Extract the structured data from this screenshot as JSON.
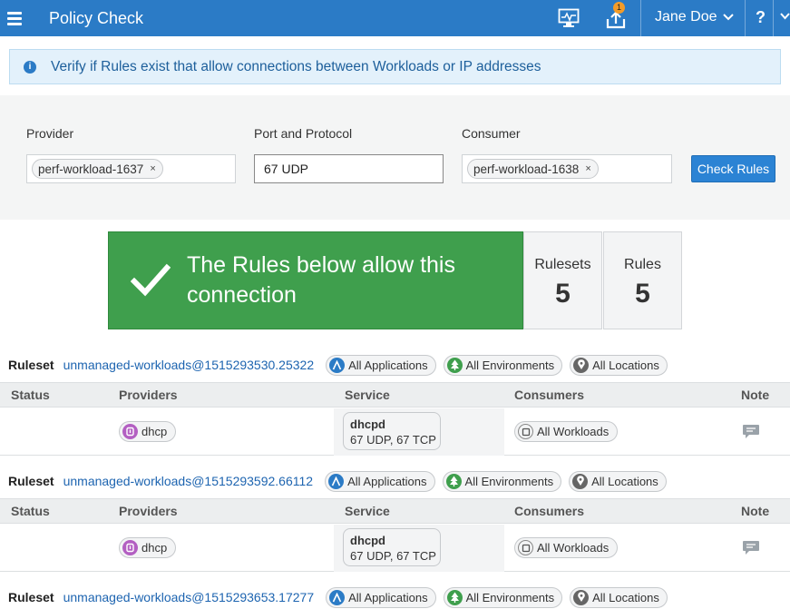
{
  "header": {
    "menu_icon": "hamburger-icon",
    "title": "Policy Check",
    "monitor_icon": "monitor-icon",
    "upload_icon": "upload-icon",
    "notification_count": "1",
    "user_name": "Jane Doe",
    "help_label": "?"
  },
  "info": {
    "icon": "info-icon",
    "text": "Verify if Rules exist that allow connections between Workloads or IP addresses"
  },
  "form": {
    "provider_label": "Provider",
    "provider_chip": "perf-workload-1637",
    "port_label": "Port and Protocol",
    "port_value": "67 UDP",
    "consumer_label": "Consumer",
    "consumer_chip": "perf-workload-1638",
    "check_button": "Check Rules",
    "chip_remove": "×"
  },
  "result": {
    "message": "The Rules below allow this connection",
    "rulesets_label": "Rulesets",
    "rulesets_count": "5",
    "rules_label": "Rules",
    "rules_count": "5",
    "colors": {
      "success": "#3f9f4d"
    }
  },
  "table_columns": {
    "status": "Status",
    "providers": "Providers",
    "service": "Service",
    "consumers": "Consumers",
    "note": "Note"
  },
  "rulesets": [
    {
      "label": "Ruleset",
      "name": "unmanaged-workloads@1515293530.25322",
      "applications": "All Applications",
      "environments": "All Environments",
      "locations": "All Locations",
      "provider": "dhcp",
      "service_name": "dhcpd",
      "service_ports": "67 UDP, 67 TCP",
      "consumer": "All Workloads"
    },
    {
      "label": "Ruleset",
      "name": "unmanaged-workloads@1515293592.66112",
      "applications": "All Applications",
      "environments": "All Environments",
      "locations": "All Locations",
      "provider": "dhcp",
      "service_name": "dhcpd",
      "service_ports": "67 UDP, 67 TCP",
      "consumer": "All Workloads"
    },
    {
      "label": "Ruleset",
      "name": "unmanaged-workloads@1515293653.17277",
      "applications": "All Applications",
      "environments": "All Environments",
      "locations": "All Locations"
    }
  ]
}
